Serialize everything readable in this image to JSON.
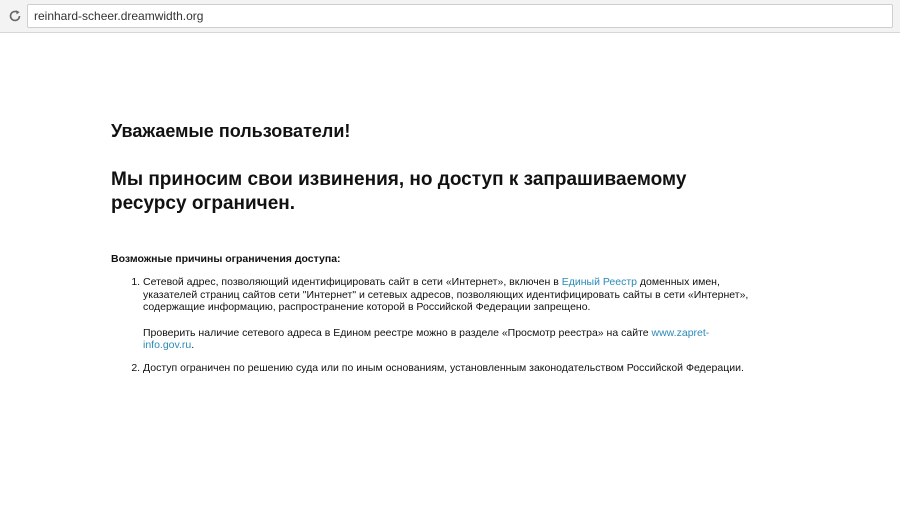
{
  "browser": {
    "url": "reinhard-scheer.dreamwidth.org",
    "reload_icon": "reload-icon"
  },
  "page": {
    "greeting": "Уважаемые пользователи!",
    "apology": "Мы приносим свои извинения, но доступ к запрашиваемому ресурсу ограничен.",
    "reasons_title": "Возможные причины ограничения доступа:",
    "reason1": {
      "text_before_link": "Сетевой адрес, позволяющий идентифицировать сайт в сети «Интернет», включен в ",
      "registry_link": "Единый Реестр",
      "text_after_link": " доменных имен, указателей страниц сайтов сети \"Интернет\" и сетевых адресов, позволяющих идентифицировать сайты в сети «Интернет», содержащие информацию, распространение которой в Российской Федерации запрещено.",
      "check_text": "Проверить наличие сетевого адреса в Едином реестре можно в разделе «Просмотр реестра» на сайте ",
      "site_link": "www.zapret-info.gov.ru",
      "check_end": "."
    },
    "reason2": "Доступ ограничен  по решению суда или по иным основаниям, установленным законодательством Российской Федерации."
  },
  "colors": {
    "link": "#2a8ab8",
    "text": "#111111"
  }
}
